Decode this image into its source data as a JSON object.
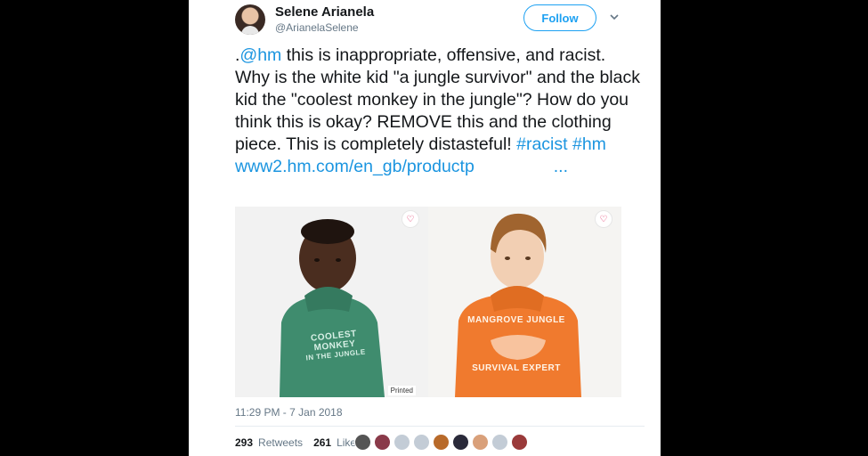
{
  "tweet": {
    "author_name": "Selene Arianela",
    "author_handle": "@ArianelaSelene",
    "follow_label": "Follow",
    "line1_prefix": ".",
    "mention": "@hm",
    "line1_rest": " this is inappropriate, offensive, and",
    "body_main": "racist. Why is the white kid \"a jungle survivor\" and the black kid the \"coolest monkey in the jungle\"? How do you think this is okay? REMOVE this and the clothing piece. This is completely distasteful! ",
    "hashtag1": "#racist",
    "hashtag2": "#hm",
    "url_text": "www2.hm.com/en_gb/productp",
    "url_ellipsis": "...",
    "timestamp": "11:29 PM - 7 Jan 2018",
    "retweets_count": "293",
    "retweets_label": "Retweets",
    "likes_count": "261",
    "likes_label": "Likes"
  },
  "media": {
    "photo1_shirt_line1": "COOLEST MONKEY",
    "photo1_shirt_line2": "IN THE JUNGLE",
    "photo2_shirt_line1": "MANGROVE JUNGLE",
    "photo2_shirt_line2": "SURVIVAL EXPERT",
    "printed_label": "Printed"
  },
  "colors": {
    "accent": "#1da1f2",
    "link": "#1b95e0",
    "hoodie_green": "#3f8c6e",
    "hoodie_orange": "#f07a2e"
  }
}
